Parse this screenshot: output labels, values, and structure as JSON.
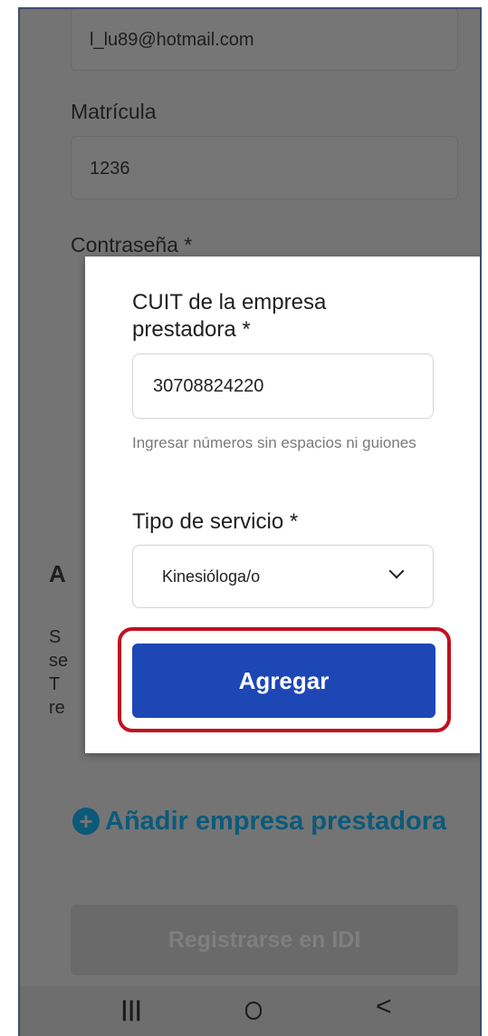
{
  "background_form": {
    "email_value": "l_lu89@hotmail.com",
    "matricula_label": "Matrícula",
    "matricula_value": "1236",
    "password_label": "Contraseña *",
    "partial_heading": "A",
    "partial_lines": [
      "S",
      "se",
      "T",
      "re"
    ],
    "add_company_label": "Añadir empresa prestadora",
    "register_button": "Registrarse en IDI"
  },
  "modal": {
    "cuit_label": "CUIT de la empresa prestadora *",
    "cuit_value": "30708824220",
    "cuit_hint": "Ingresar números sin espacios ni guiones",
    "service_label": "Tipo de servicio *",
    "service_value": "Kinesióloga/o",
    "submit_button": "Agregar"
  },
  "navbar": {
    "recents_icon": "|||",
    "back_icon": "<"
  },
  "colors": {
    "primary_button": "#1e47b6",
    "highlight": "#c0101f",
    "link": "#0b5a7a",
    "overlay": "#747474"
  }
}
